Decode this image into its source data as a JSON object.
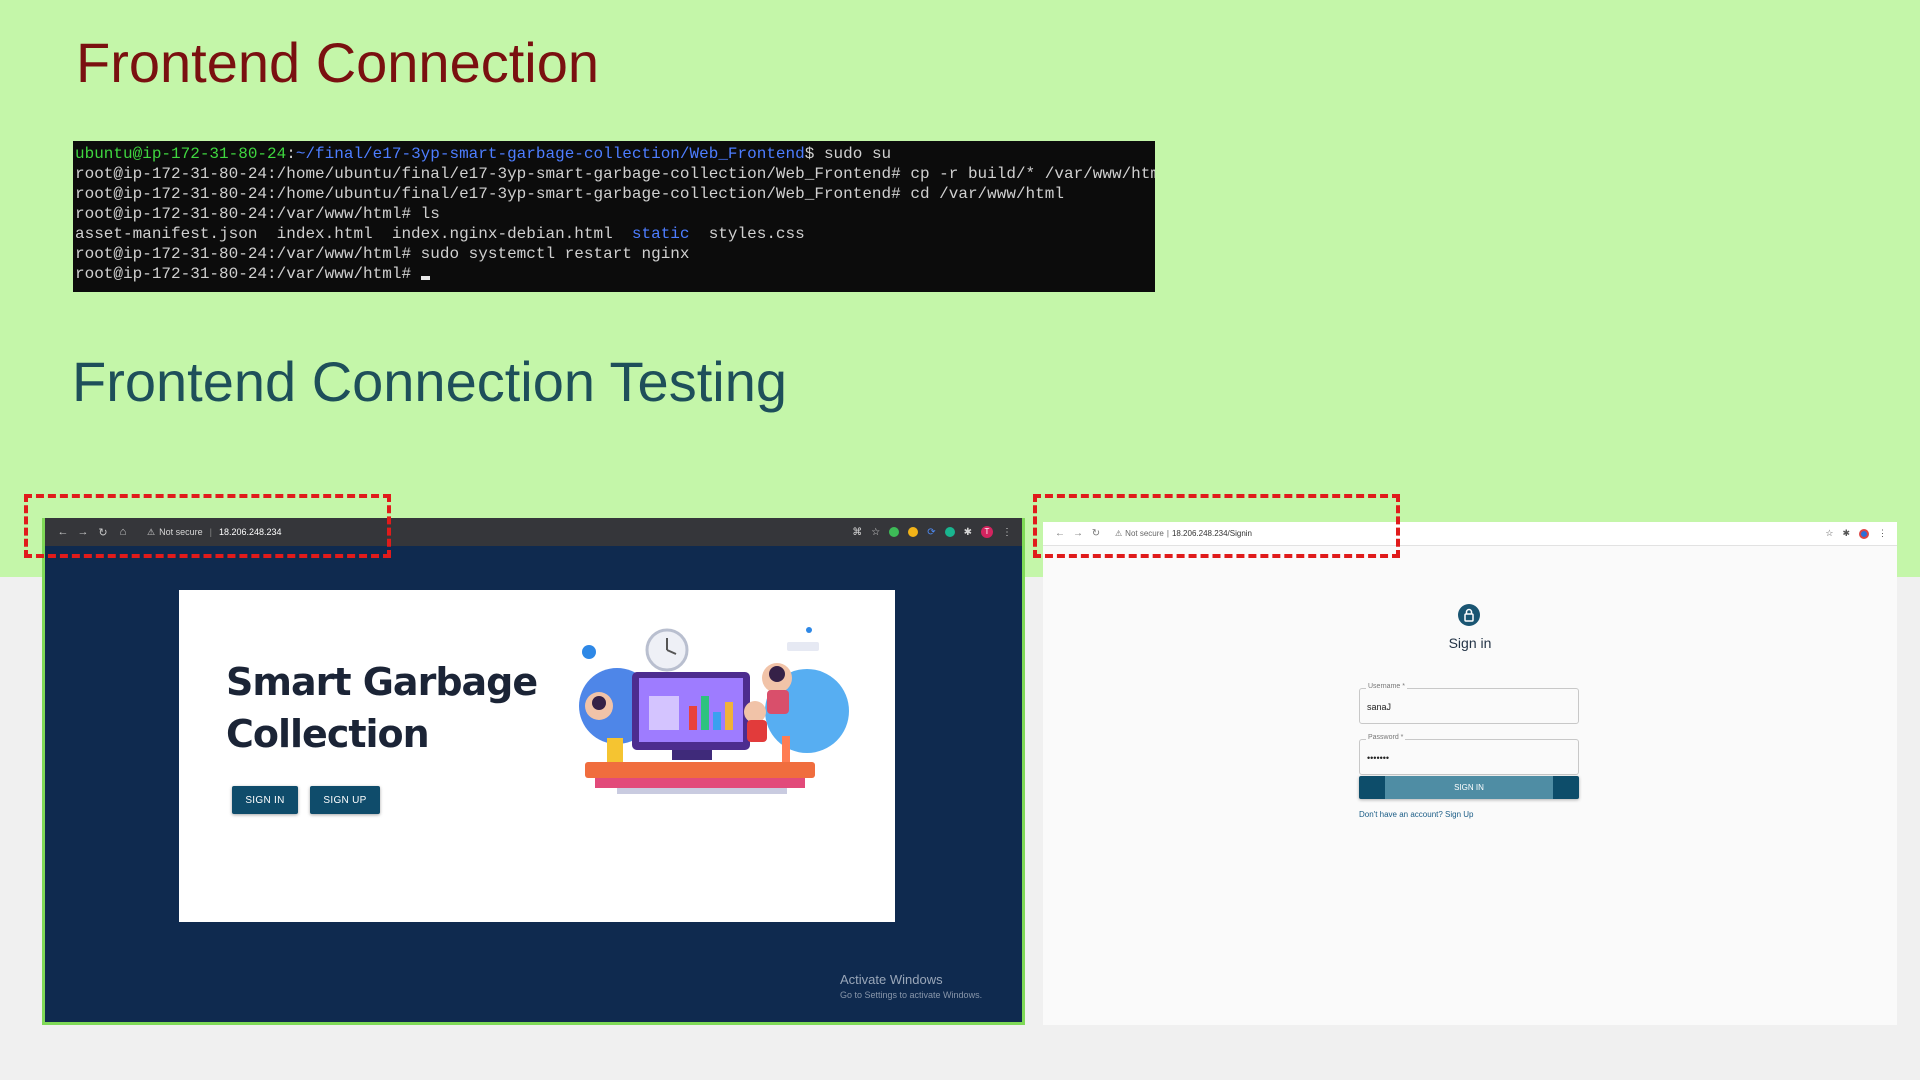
{
  "slide": {
    "title_connection": "Frontend Connection",
    "title_testing": "Frontend Connection Testing"
  },
  "terminal": {
    "line1": {
      "user_host": "ubuntu@ip-172-31-80-24",
      "colon": ":",
      "path": "~/final/e17-3yp-smart-garbage-collection/Web_Frontend",
      "rest": "$ sudo su"
    },
    "line2": "root@ip-172-31-80-24:/home/ubuntu/final/e17-3yp-smart-garbage-collection/Web_Frontend# cp -r build/* /var/www/html",
    "line3": "root@ip-172-31-80-24:/home/ubuntu/final/e17-3yp-smart-garbage-collection/Web_Frontend# cd /var/www/html",
    "line4": "root@ip-172-31-80-24:/var/www/html# ls",
    "line5": {
      "files_before": "asset-manifest.json  index.html  index.nginx-debian.html  ",
      "dir": "static",
      "files_after": "  styles.css"
    },
    "line6": "root@ip-172-31-80-24:/var/www/html# sudo systemctl restart nginx",
    "line7": "root@ip-172-31-80-24:/var/www/html# "
  },
  "left_browser": {
    "security_label": "Not secure",
    "separator": "|",
    "url": "18.206.248.234",
    "avatar_letter": "T",
    "hero_title_line1": "Smart Garbage",
    "hero_title_line2": "Collection",
    "sign_in_label": "SIGN IN",
    "sign_up_label": "SIGN UP",
    "activate_title": "Activate Windows",
    "activate_sub": "Go to Settings to activate Windows."
  },
  "right_browser": {
    "security_label": "Not secure",
    "separator": "|",
    "url": "18.206.248.234/Signin",
    "heading": "Sign in",
    "username_label": "Username *",
    "username_value": "sanaJ",
    "password_label": "Password *",
    "password_value": "•••••••",
    "submit_label": "SIGN IN",
    "signup_link": "Don't have an account? Sign Up"
  },
  "colors": {
    "slide_bg": "#c4f6a9",
    "title_connection": "#7a1010",
    "title_testing": "#1e4f5a",
    "highlight": "#e01b1b",
    "brand_dark": "#0f4c6b"
  }
}
